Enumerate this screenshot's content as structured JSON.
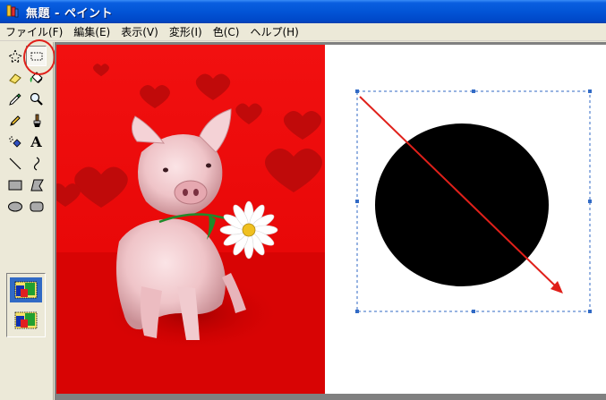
{
  "window": {
    "title": "無題 - ペイント",
    "accent": "#0254d6"
  },
  "menu": {
    "items": [
      {
        "label": "ファイル(F)",
        "name": "menu-file"
      },
      {
        "label": "編集(E)",
        "name": "menu-edit"
      },
      {
        "label": "表示(V)",
        "name": "menu-view"
      },
      {
        "label": "変形(I)",
        "name": "menu-image"
      },
      {
        "label": "色(C)",
        "name": "menu-colors"
      },
      {
        "label": "ヘルプ(H)",
        "name": "menu-help"
      }
    ]
  },
  "toolbox": {
    "tools": [
      {
        "name": "free-form-select-tool",
        "icon": "free-select-icon",
        "active": false
      },
      {
        "name": "rectangle-select-tool",
        "icon": "rect-select-icon",
        "active": true
      },
      {
        "name": "eraser-tool",
        "icon": "eraser-icon",
        "active": false
      },
      {
        "name": "fill-tool",
        "icon": "paint-bucket-icon",
        "active": false
      },
      {
        "name": "pick-color-tool",
        "icon": "eyedropper-icon",
        "active": false
      },
      {
        "name": "magnifier-tool",
        "icon": "magnifier-icon",
        "active": false
      },
      {
        "name": "pencil-tool",
        "icon": "pencil-icon",
        "active": false
      },
      {
        "name": "brush-tool",
        "icon": "brush-icon",
        "active": false
      },
      {
        "name": "airbrush-tool",
        "icon": "airbrush-icon",
        "active": false
      },
      {
        "name": "text-tool",
        "icon": "text-icon",
        "active": false
      },
      {
        "name": "line-tool",
        "icon": "line-icon",
        "active": false
      },
      {
        "name": "curve-tool",
        "icon": "curve-icon",
        "active": false
      },
      {
        "name": "rectangle-tool",
        "icon": "rectangle-icon",
        "active": false
      },
      {
        "name": "polygon-tool",
        "icon": "polygon-icon",
        "active": false
      },
      {
        "name": "ellipse-tool",
        "icon": "ellipse-icon",
        "active": false
      },
      {
        "name": "rounded-rectangle-tool",
        "icon": "rounded-rectangle-icon",
        "active": false
      }
    ],
    "text_tool_glyph": "A",
    "selection_options": [
      {
        "name": "opaque-selection-option",
        "selected": true
      },
      {
        "name": "transparent-selection-option",
        "selected": false
      }
    ]
  },
  "canvas": {
    "background_color": "#ffffff",
    "photo": {
      "subject": "pig holding daisy on red background with hearts",
      "background_color": "#ee0a0a"
    },
    "shapes": {
      "ellipse_fill": "#000000",
      "arrow_color": "#e0201a",
      "selection_border_color": "#316ac5"
    }
  },
  "annotation": {
    "color": "#e0201a",
    "target": "rectangle-select-tool"
  }
}
